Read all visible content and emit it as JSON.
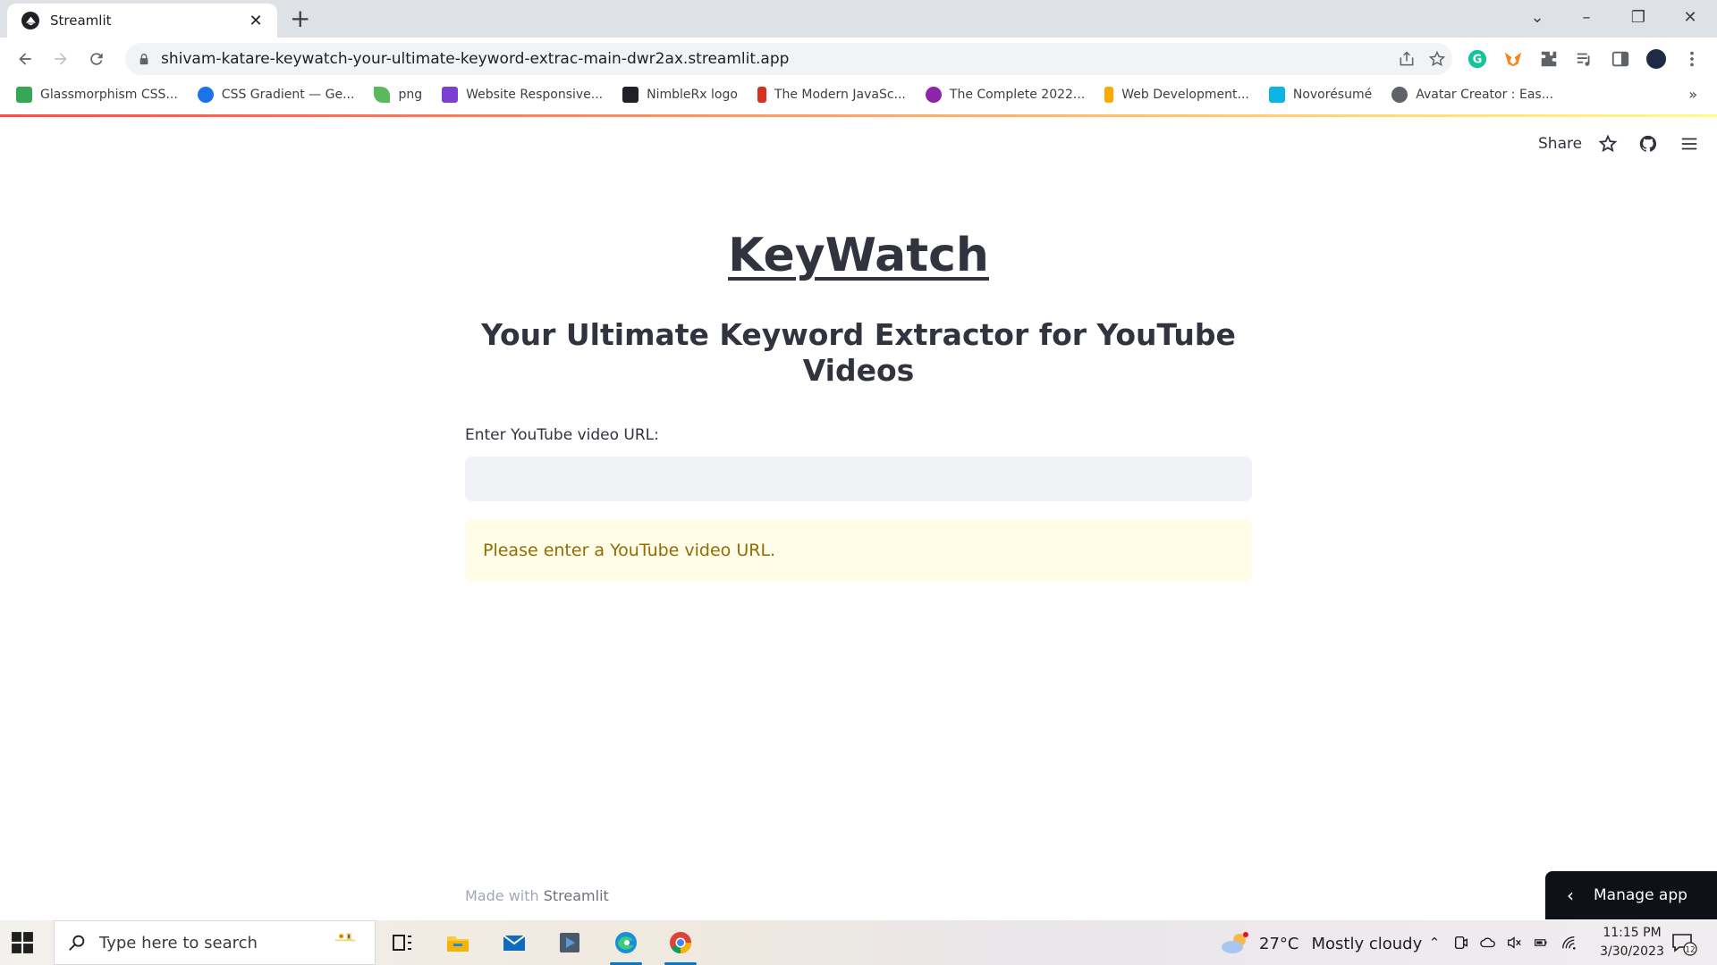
{
  "browser": {
    "tab_title": "Streamlit",
    "tab_close": "✕",
    "new_tab": "+",
    "url": "shivam-katare-keywatch-your-ultimate-keyword-extrac-main-dwr2ax.streamlit.app",
    "bookmarks": [
      {
        "label": "Glassmorphism CSS...",
        "color": "#34a853"
      },
      {
        "label": "CSS Gradient — Ge...",
        "color": "#1a73e8"
      },
      {
        "label": "png",
        "color": "#5cb85c"
      },
      {
        "label": "Website Responsive...",
        "color": "#7b3fd1"
      },
      {
        "label": "NimbleRx logo",
        "color": "#202124"
      },
      {
        "label": "The Modern JavaSc...",
        "color": "#d93025"
      },
      {
        "label": "The Complete 2022...",
        "color": "#8e24aa"
      },
      {
        "label": "Web Development...",
        "color": "#f9ab00"
      },
      {
        "label": "Novorésumé",
        "color": "#0bb5e8"
      },
      {
        "label": "Avatar Creator : Eas...",
        "color": "#5f6368"
      }
    ],
    "bookmarks_more": "»"
  },
  "app": {
    "share_label": "Share",
    "title": "KeyWatch",
    "subtitle": "Your Ultimate Keyword Extractor for YouTube Videos",
    "input_label": "Enter YouTube video URL:",
    "input_value": "",
    "warning": "Please enter a YouTube video URL.",
    "footer_prefix": "Made with ",
    "footer_brand": "Streamlit",
    "manage_app": "Manage app",
    "manage_chevron": "‹"
  },
  "taskbar": {
    "search_placeholder": "Type here to search",
    "weather_temp": "27°C",
    "weather_desc": "Mostly cloudy",
    "time": "11:15 PM",
    "date": "3/30/2023",
    "notification_count": "12"
  },
  "colors": {
    "accent_red": "#ff4b4b",
    "warning_bg": "#fffce7",
    "warning_text": "#926c05",
    "input_bg": "#f0f2f6"
  }
}
